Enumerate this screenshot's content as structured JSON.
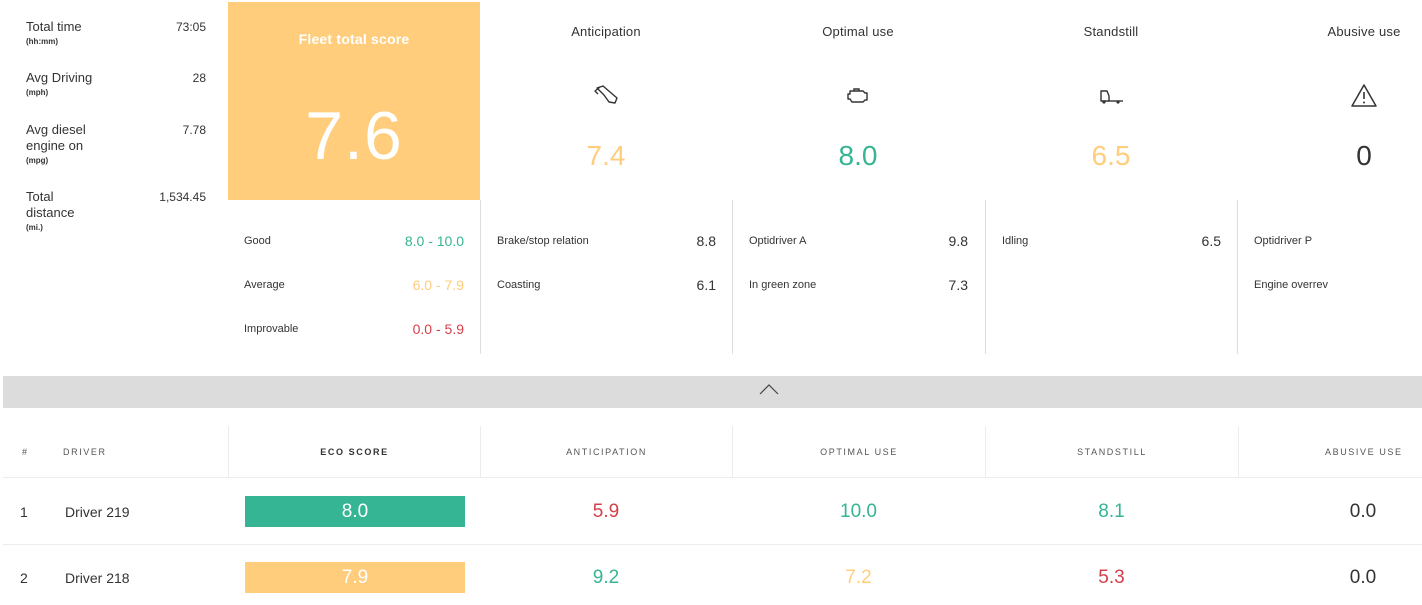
{
  "stats": [
    {
      "label": "Total time",
      "unit": "(hh:mm)",
      "value": "73:05"
    },
    {
      "label": "Avg Driving",
      "unit": "(mph)",
      "value": "28"
    },
    {
      "label": "Avg diesel engine on",
      "unit": "(mpg)",
      "value": "7.78"
    },
    {
      "label": "Total distance",
      "unit": "(mi.)",
      "value": "1,534.45"
    }
  ],
  "fleet": {
    "title": "Fleet total score",
    "score": "7.6"
  },
  "categories": [
    {
      "name": "Anticipation",
      "icon": "foot-pedal-icon",
      "score": "7.4",
      "color": "#ffcd7c"
    },
    {
      "name": "Optimal use",
      "icon": "engine-icon",
      "score": "8.0",
      "color": "#35b594"
    },
    {
      "name": "Standstill",
      "icon": "idle-truck-icon",
      "score": "6.5",
      "color": "#ffcd7c"
    },
    {
      "name": "Abusive use",
      "icon": "warning-icon",
      "score": "0",
      "color": "#333333"
    }
  ],
  "legend": [
    {
      "label": "Good",
      "range": "8.0 - 10.0",
      "color": "#35b594"
    },
    {
      "label": "Average",
      "range": "6.0 - 7.9",
      "color": "#ffcd7c"
    },
    {
      "label": "Improvable",
      "range": "0.0 - 5.9",
      "color": "#d4404a"
    }
  ],
  "details": {
    "anticipation": [
      {
        "label": "Brake/stop relation",
        "value": "8.8"
      },
      {
        "label": "Coasting",
        "value": "6.1"
      }
    ],
    "optimal_use": [
      {
        "label": "Optidriver A",
        "value": "9.8"
      },
      {
        "label": "In green zone",
        "value": "7.3"
      }
    ],
    "standstill": [
      {
        "label": "Idling",
        "value": "6.5"
      }
    ],
    "abusive_use": [
      {
        "label": "Optidriver P",
        "value": ""
      },
      {
        "label": "Engine overrev",
        "value": ""
      }
    ]
  },
  "table": {
    "headers": {
      "index": "#",
      "driver": "DRIVER",
      "eco_score": "ECO SCORE",
      "anticipation": "ANTICIPATION",
      "optimal_use": "OPTIMAL USE",
      "standstill": "STANDSTILL",
      "abusive_use": "ABUSIVE USE"
    },
    "rows": [
      {
        "index": "1",
        "driver": "Driver 219",
        "eco_score": "8.0",
        "eco_color": "#35b594",
        "anticipation": "5.9",
        "anticipation_color": "#d4404a",
        "optimal_use": "10.0",
        "optimal_color": "#35b594",
        "standstill": "8.1",
        "standstill_color": "#35b594",
        "abusive_use": "0.0",
        "abusive_color": "#333333"
      },
      {
        "index": "2",
        "driver": "Driver 218",
        "eco_score": "7.9",
        "eco_color": "#ffcd7c",
        "anticipation": "9.2",
        "anticipation_color": "#35b594",
        "optimal_use": "7.2",
        "optimal_color": "#ffcd7c",
        "standstill": "5.3",
        "standstill_color": "#d4404a",
        "abusive_use": "0.0",
        "abusive_color": "#333333"
      }
    ]
  },
  "collapse": {
    "icon": "chevron-up-icon"
  }
}
